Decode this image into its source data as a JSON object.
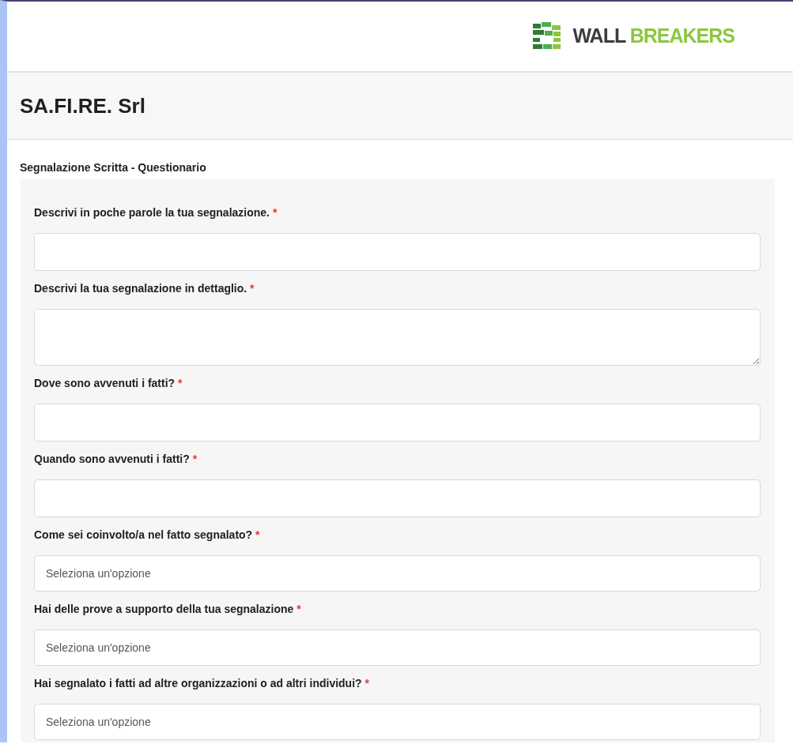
{
  "logo": {
    "dark_part": "WALL",
    "green_part": "BREAKERS"
  },
  "company": {
    "title": "SA.FI.RE. Srl"
  },
  "section": {
    "title": "Segnalazione Scritta - Questionario"
  },
  "fields": [
    {
      "kind": "text",
      "label": "Descrivi in poche parole la tua segnalazione.",
      "required_mark": "*"
    },
    {
      "kind": "textarea",
      "label": "Descrivi la tua segnalazione in dettaglio.",
      "required_mark": "*"
    },
    {
      "kind": "text",
      "label": "Dove sono avvenuti i fatti?",
      "required_mark": "*"
    },
    {
      "kind": "text",
      "label": "Quando sono avvenuti i fatti?",
      "required_mark": "*"
    },
    {
      "kind": "select",
      "label": "Come sei coinvolto/a nel fatto segnalato?",
      "required_mark": "*",
      "placeholder": "Seleziona un'opzione"
    },
    {
      "kind": "select",
      "label": "Hai delle prove a supporto della tua segnalazione",
      "required_mark": "*",
      "placeholder": "Seleziona un'opzione"
    },
    {
      "kind": "select",
      "label": "Hai segnalato i fatti ad altre organizzazioni o ad altri individui?",
      "required_mark": "*",
      "placeholder": "Seleziona un'opzione"
    }
  ]
}
